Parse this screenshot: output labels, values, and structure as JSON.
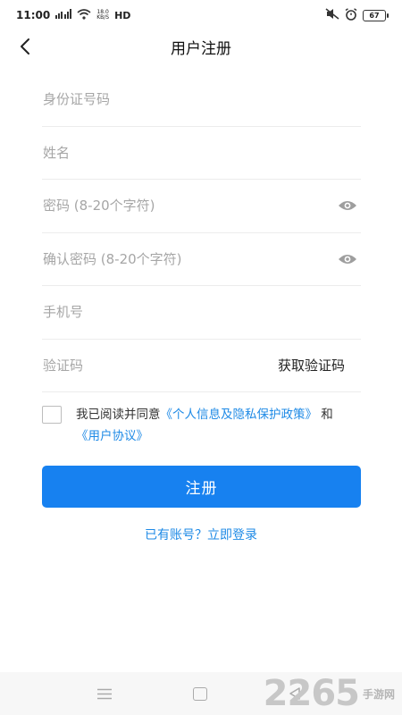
{
  "status_bar": {
    "time": "11:00",
    "net_speed": "18.0",
    "net_unit": "KB/S",
    "hd": "HD",
    "battery": "67"
  },
  "header": {
    "title": "用户注册",
    "back_icon": "chevron-left-icon"
  },
  "form": {
    "id_placeholder": "身份证号码",
    "name_placeholder": "姓名",
    "password_placeholder": "密码 (8-20个字符)",
    "confirm_placeholder": "确认密码 (8-20个字符)",
    "phone_placeholder": "手机号",
    "code_placeholder": "验证码",
    "get_code_label": "获取验证码",
    "eye_icon": "eye-icon"
  },
  "agreement": {
    "prefix": "我已阅读并同意",
    "privacy_link": "《个人信息及隐私保护政策》",
    "joiner": "和",
    "terms_link": "《用户协议》"
  },
  "register_label": "注册",
  "login_link": "已有账号？立即登录",
  "watermark": {
    "number": "2265",
    "text": "手游网"
  },
  "colors": {
    "primary": "#1781f0",
    "link": "#1e8ae6",
    "placeholder": "#a6a6a6",
    "divider": "#ececec"
  }
}
